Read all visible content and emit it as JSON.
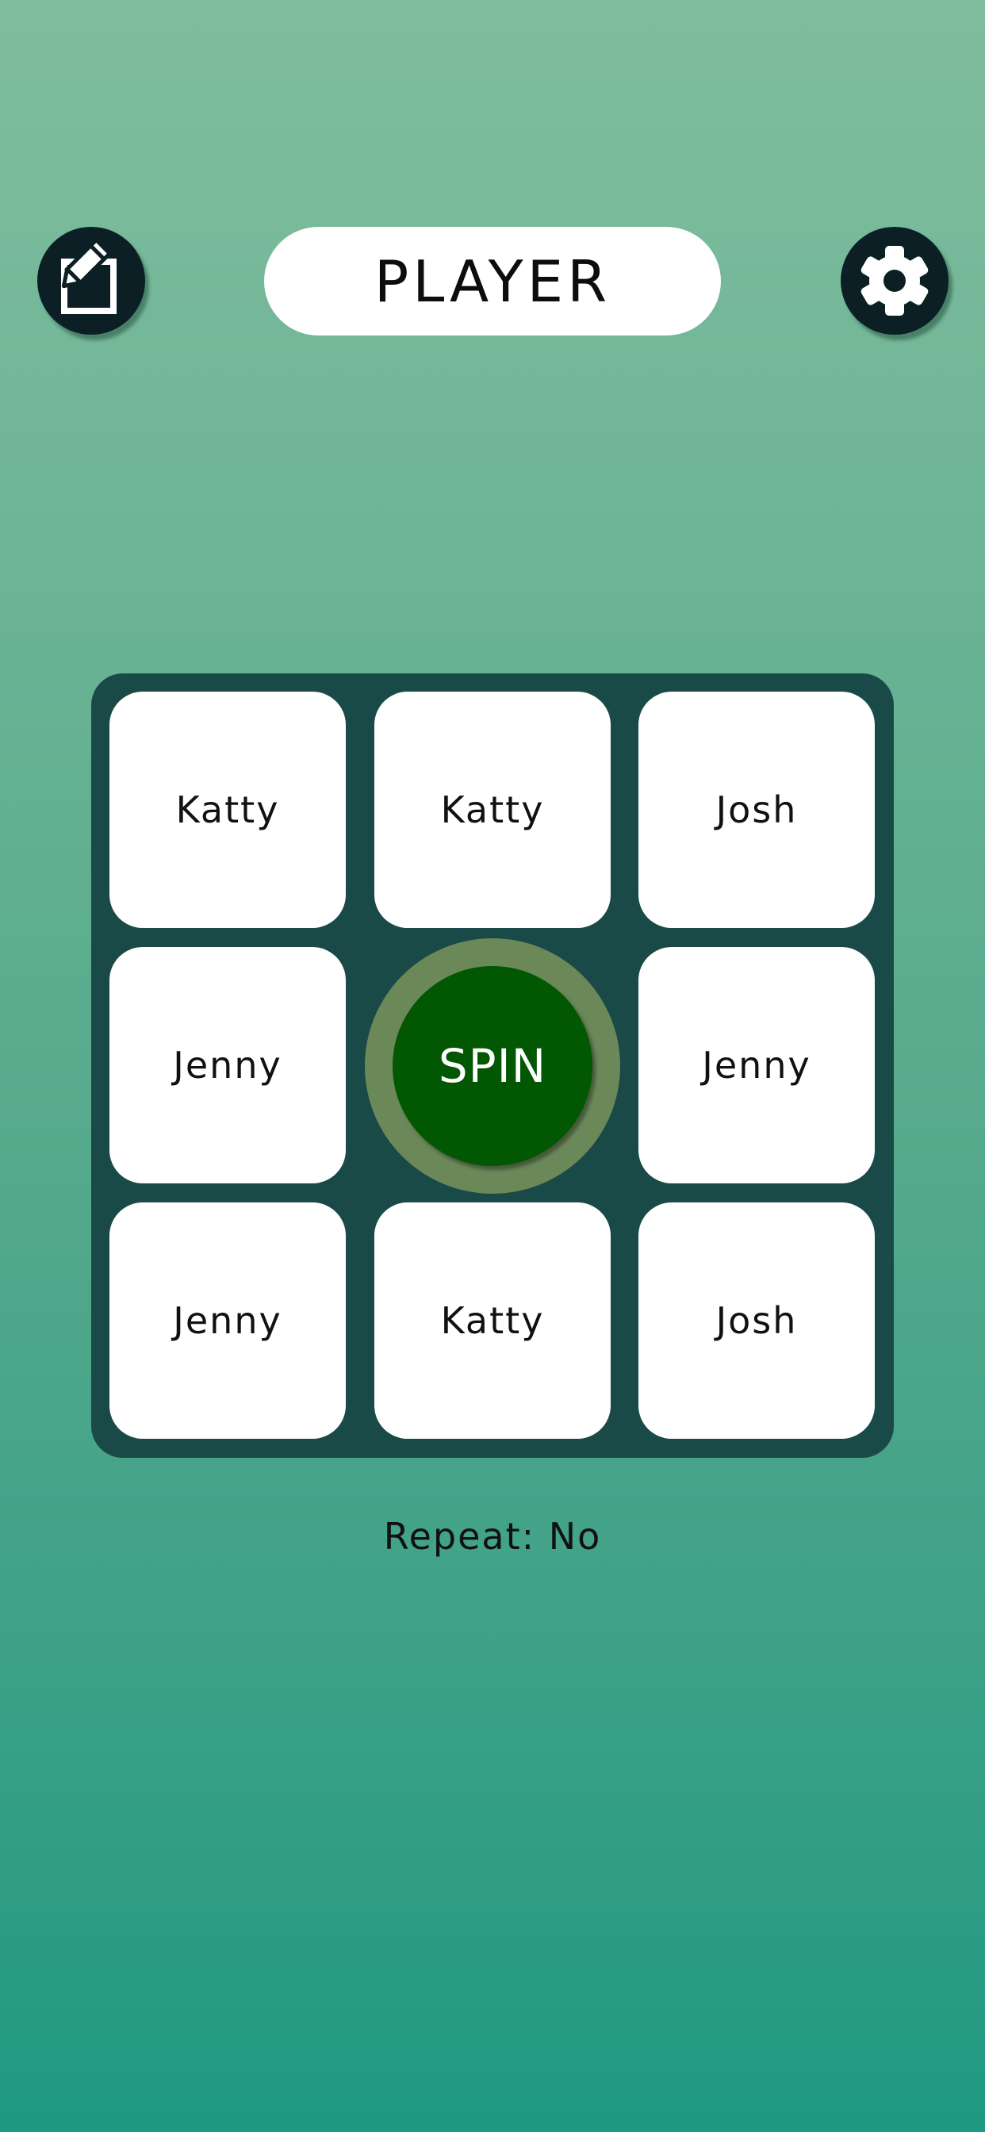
{
  "header": {
    "title": "PLAYER",
    "left_icon": "edit-square-pencil-icon",
    "right_icon": "gear-icon"
  },
  "grid": {
    "tiles": [
      "Katty",
      "Katty",
      "Josh",
      "Jenny",
      "Jenny",
      "Jenny",
      "Katty",
      "Josh"
    ],
    "spin_label": "SPIN"
  },
  "footer": {
    "repeat_label": "Repeat: No"
  },
  "colors": {
    "board": "#1a4a47",
    "spin_button": "#025702",
    "spin_ring": "#6b8859",
    "icon_button": "#0b1f25"
  }
}
